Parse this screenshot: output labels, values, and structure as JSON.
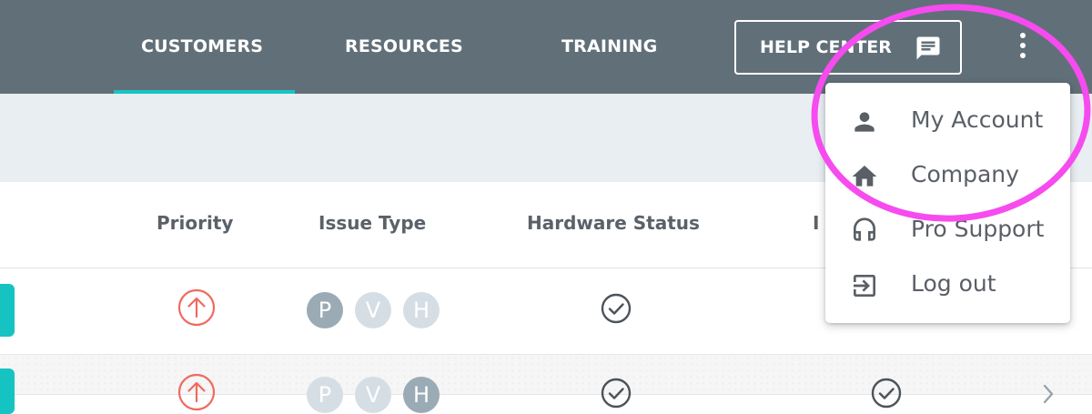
{
  "nav": {
    "tabs": [
      {
        "label": "CUSTOMERS",
        "active": true
      },
      {
        "label": "RESOURCES",
        "active": false
      },
      {
        "label": "TRAINING",
        "active": false
      }
    ],
    "help_center_label": "HELP CENTER",
    "help_center_icon": "chat-bubble-icon",
    "more_icon": "kebab-menu-icon"
  },
  "table": {
    "headers": [
      "Priority",
      "Issue Type",
      "Hardware Status",
      "I"
    ],
    "rows": [
      {
        "priority_icon": "arrow-up-circle-icon",
        "issue_types": [
          "P",
          "V",
          "H"
        ],
        "issue_active": [
          true,
          false,
          false
        ],
        "hardware_status_icon": "check-circle-icon"
      },
      {
        "priority_icon": "arrow-up-circle-icon",
        "issue_types": [
          "P",
          "V",
          "H"
        ],
        "issue_active": [
          false,
          false,
          true
        ],
        "hardware_status_icon": "check-circle-icon",
        "extra_icon": "check-circle-icon"
      }
    ]
  },
  "menu": {
    "items": [
      {
        "label": "My Account",
        "icon": "person-icon"
      },
      {
        "label": "Company",
        "icon": "home-icon"
      },
      {
        "label": "Pro Support",
        "icon": "headset-icon"
      },
      {
        "label": "Log out",
        "icon": "logout-icon"
      }
    ]
  },
  "colors": {
    "nav_bg": "#616f79",
    "accent": "#19c4c4",
    "priority_red": "#f06a5f",
    "highlight_pink": "#f64bef",
    "band_bg": "#e8eef1"
  }
}
